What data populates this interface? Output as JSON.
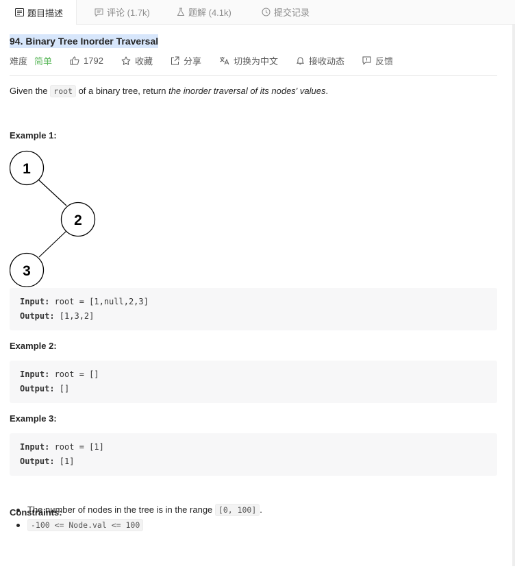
{
  "tabs": [
    {
      "label": "题目描述",
      "icon": "description-icon"
    },
    {
      "label": "评论 (1.7k)",
      "icon": "comment-icon"
    },
    {
      "label": "题解 (4.1k)",
      "icon": "flask-icon"
    },
    {
      "label": "提交记录",
      "icon": "clock-icon"
    }
  ],
  "problem": {
    "title": "94. Binary Tree Inorder Traversal",
    "difficulty_label": "难度",
    "difficulty": "简单",
    "likes": "1792",
    "actions": [
      "收藏",
      "分享",
      "切换为中文",
      "接收动态",
      "反馈"
    ]
  },
  "description": {
    "part1": "Given the ",
    "code": "root",
    "part2": " of a binary tree, return ",
    "emph": "the inorder traversal of its nodes' values",
    "part3": "."
  },
  "examples": [
    {
      "heading": "Example 1:",
      "input_label": "Input:",
      "input": " root = [1,null,2,3]",
      "output_label": "Output:",
      "output": " [1,3,2]"
    },
    {
      "heading": "Example 2:",
      "input_label": "Input:",
      "input": " root = []",
      "output_label": "Output:",
      "output": " []"
    },
    {
      "heading": "Example 3:",
      "input_label": "Input:",
      "input": " root = [1]",
      "output_label": "Output:",
      "output": " [1]"
    }
  ],
  "tree_nodes": [
    "1",
    "2",
    "3"
  ],
  "constraints": {
    "heading": "Constraints:",
    "c1_text": "The number of nodes in the tree is in the range ",
    "c1_code": "[0, 100]",
    "c1_end": ".",
    "c2_code": "-100 <= Node.val <= 100"
  }
}
